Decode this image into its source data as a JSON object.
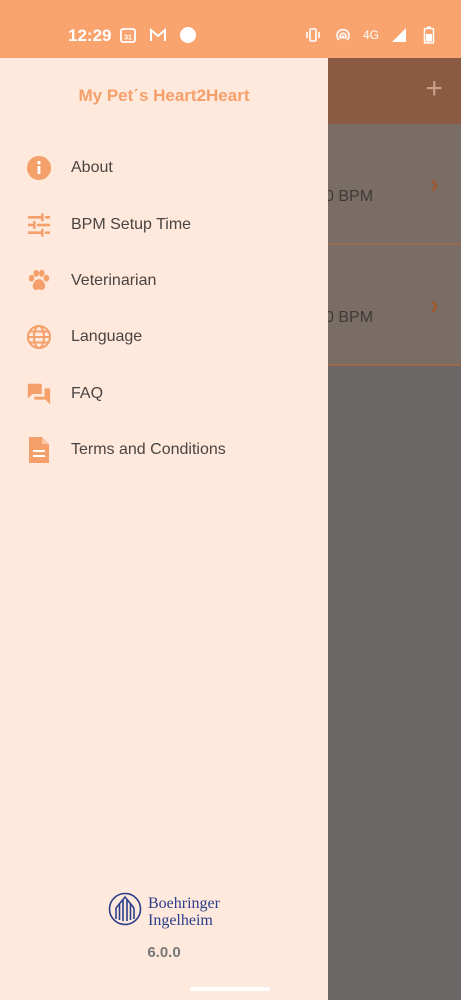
{
  "status_bar": {
    "time": "12:29",
    "network_label": "4G"
  },
  "drawer": {
    "title": "My Pet´s Heart2Heart",
    "items": [
      {
        "label": "About",
        "icon": "info-icon"
      },
      {
        "label": "BPM Setup Time",
        "icon": "sliders-icon"
      },
      {
        "label": "Veterinarian",
        "icon": "paw-icon"
      },
      {
        "label": "Language",
        "icon": "globe-icon"
      },
      {
        "label": "FAQ",
        "icon": "chat-icon"
      },
      {
        "label": "Terms and Conditions",
        "icon": "document-icon"
      }
    ],
    "brand_line1": "Boehringer",
    "brand_line2": "Ingelheim",
    "version": "6.0.0"
  },
  "background_list": {
    "rows": [
      {
        "text": "0 BPM"
      },
      {
        "text": "0 BPM"
      }
    ],
    "add_icon": "plus-icon"
  },
  "colors": {
    "accent": "#f9a46f",
    "drawer_bg": "#ffe8dc",
    "brand_blue": "#2a3f8a"
  }
}
